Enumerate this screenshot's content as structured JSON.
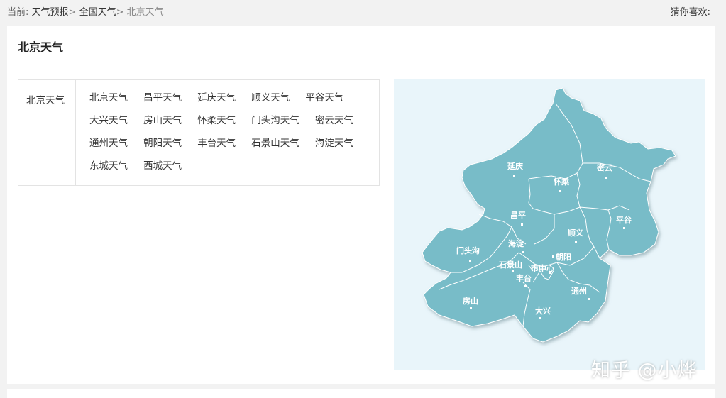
{
  "breadcrumb": {
    "prefix": "当前:",
    "items": [
      "天气预报",
      "全国天气"
    ],
    "separator": ">",
    "current": "北京天气"
  },
  "guess": {
    "label": "猜你喜欢:"
  },
  "card": {
    "title": "北京天气"
  },
  "region": {
    "label": "北京天气"
  },
  "cities": [
    [
      "北京天气",
      "昌平天气",
      "延庆天气",
      "顺义天气",
      "平谷天气"
    ],
    [
      "大兴天气",
      "房山天气",
      "怀柔天气",
      "门头沟天气",
      "密云天气"
    ],
    [
      "通州天气",
      "朝阳天气",
      "丰台天气",
      "石景山天气",
      "海淀天气"
    ],
    [
      "东城天气",
      "西城天气"
    ]
  ],
  "map": {
    "fill_color": "#78bcc8",
    "background_color": "#e9f5fa",
    "district_labels": [
      "延庆",
      "怀柔",
      "密云",
      "昌平",
      "平谷",
      "顺义",
      "门头沟",
      "海淀",
      "朝阳",
      "石景山",
      "市中心",
      "丰台",
      "通州",
      "房山",
      "大兴"
    ]
  },
  "watermark": {
    "text": "知乎 @小烨"
  }
}
